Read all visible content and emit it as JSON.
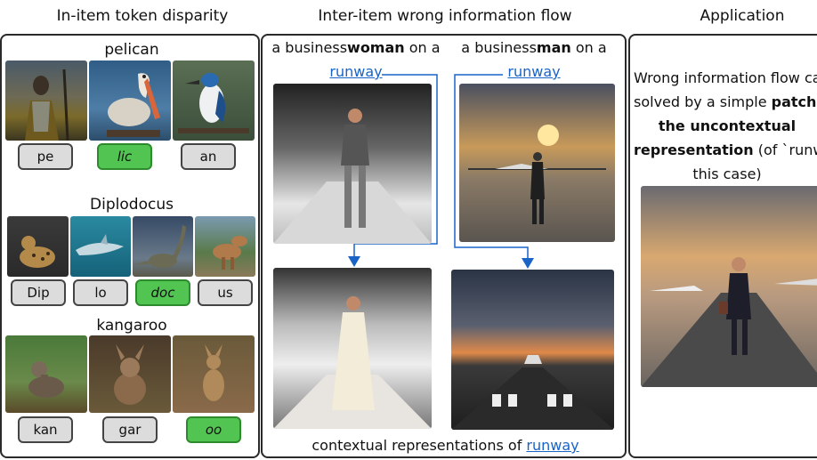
{
  "headers": {
    "left": "In-item token disparity",
    "middle": "Inter-item wrong information flow",
    "right": "Application"
  },
  "left": {
    "groups": [
      {
        "word": "pelican",
        "tokens": [
          "pe",
          "lic",
          "an"
        ],
        "highlight": "lic"
      },
      {
        "word": "Diplodocus",
        "tokens": [
          "Dip",
          "lo",
          "doc",
          "us"
        ],
        "highlight": "doc"
      },
      {
        "word": "kangaroo",
        "tokens": [
          "kan",
          "gar",
          "oo"
        ],
        "highlight": "oo"
      }
    ]
  },
  "middle": {
    "prompt_left": {
      "pre": "a business",
      "bold": "woman",
      "post": " on a",
      "link": "runway"
    },
    "prompt_right": {
      "pre": "a business",
      "bold": "man",
      "post": " on a",
      "link": "runway"
    },
    "footer": {
      "pre": "contextual representations of ",
      "link": "runway"
    }
  },
  "right": {
    "line1": "Wrong information flow can",
    "line2_pre": "solved by a simple ",
    "line2_bold": "patching",
    "line3_bold": "the uncontextual",
    "line4_bold": "representation",
    "line4_post": "  (of `runwa",
    "line5": "this case)"
  },
  "colors": {
    "accent": "#1a64c8",
    "highlight_token": "#52c452",
    "token": "#dcdcdc"
  }
}
